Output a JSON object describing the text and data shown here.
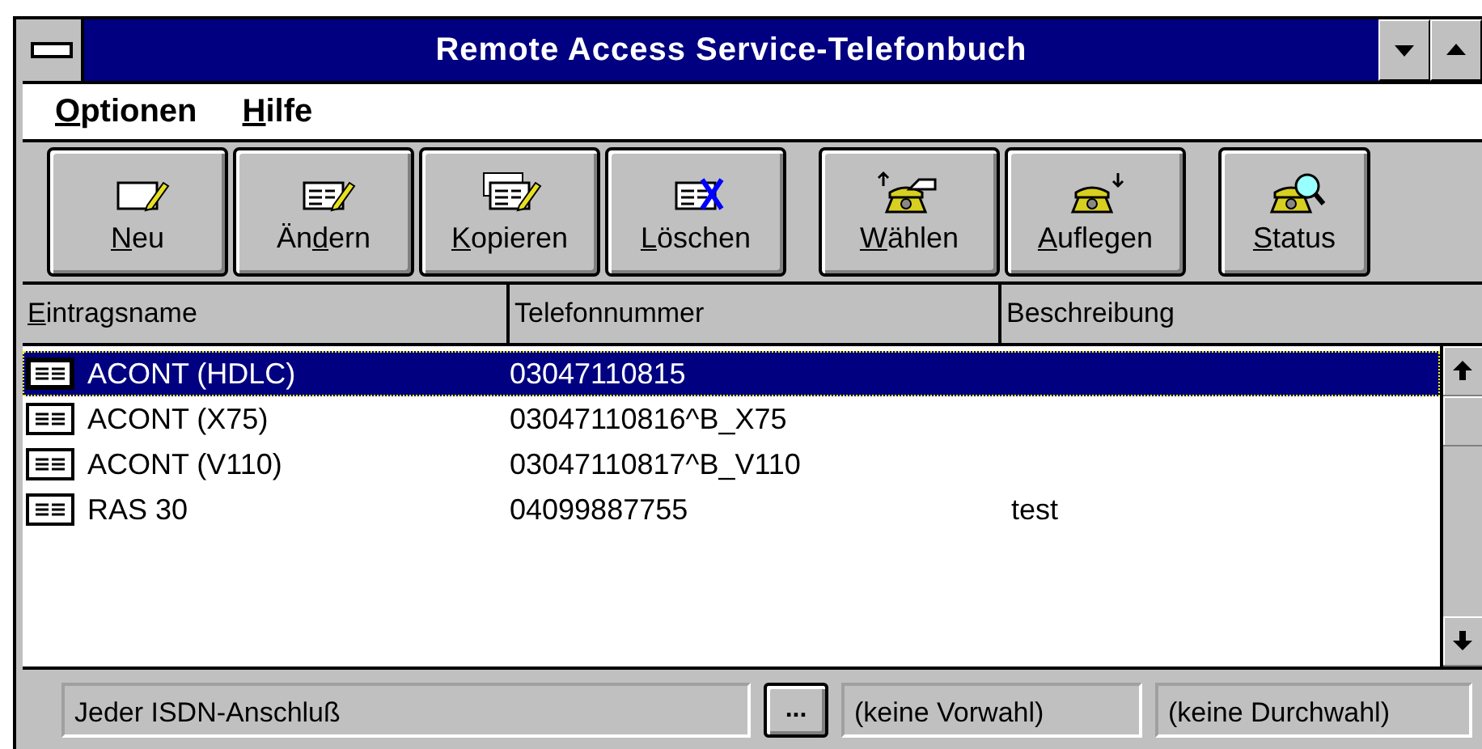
{
  "window": {
    "title": "Remote Access Service-Telefonbuch"
  },
  "menu": [
    {
      "key": "O",
      "post": "ptionen"
    },
    {
      "key": "H",
      "post": "ilfe"
    }
  ],
  "toolbar": [
    [
      {
        "key": "N",
        "post": "eu"
      },
      {
        "pre": "Än",
        "key": "d",
        "post": "ern"
      },
      {
        "key": "K",
        "post": "opieren"
      },
      {
        "key": "L",
        "post": "öschen"
      }
    ],
    [
      {
        "key": "W",
        "post": "ählen"
      },
      {
        "key": "A",
        "post": "uflegen"
      }
    ],
    [
      {
        "key": "S",
        "post": "tatus"
      }
    ]
  ],
  "table": {
    "columns": [
      {
        "key": "E",
        "post": "intragsname"
      },
      {
        "pre": "Telefonnummer"
      },
      {
        "pre": "Beschreibung"
      }
    ],
    "rows": [
      {
        "name": "ACONT (HDLC)",
        "number": "03047110815",
        "selected": true
      },
      {
        "name": "ACONT (X75)",
        "number": "03047110816^B_X75",
        "selected": false
      },
      {
        "name": "ACONT (V110)",
        "number": "03047110817^B_V110",
        "selected": false
      },
      {
        "name": "RAS 30",
        "number": "04099887755",
        "description": "test",
        "selected": false
      }
    ]
  },
  "status_bar": {
    "port": "Jeder ISDN-Anschluß",
    "browse_button": "...",
    "prefix": "(keine Vorwahl)",
    "suffix": "(keine Durchwahl)"
  }
}
